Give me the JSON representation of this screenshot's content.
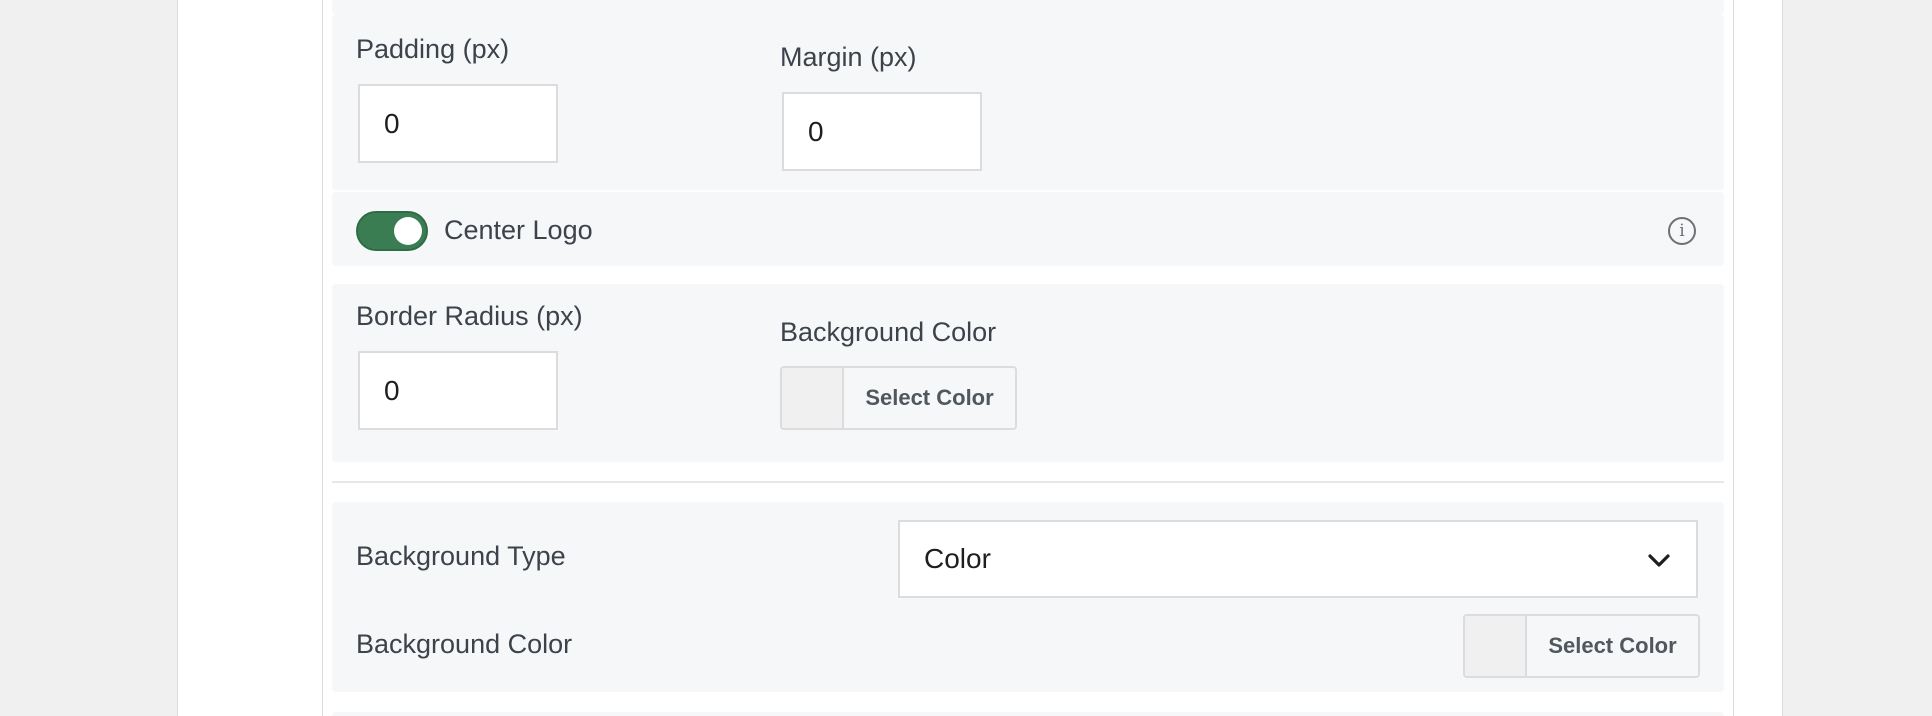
{
  "padding": {
    "label": "Padding (px)",
    "value": "0"
  },
  "margin": {
    "label": "Margin (px)",
    "value": "0"
  },
  "center_logo": {
    "label": "Center Logo",
    "enabled": true
  },
  "border_radius": {
    "label": "Border Radius (px)",
    "value": "0"
  },
  "logo_background": {
    "label": "Background Color",
    "button_label": "Select Color"
  },
  "background_type": {
    "label": "Background Type",
    "selected": "Color"
  },
  "background_color": {
    "label": "Background Color",
    "button_label": "Select Color"
  },
  "colors": {
    "toggle_on": "#3a7d52",
    "panel": "#f6f7f9"
  },
  "icons": {
    "info": "info-icon",
    "dropdown": "chevron-down-icon"
  }
}
